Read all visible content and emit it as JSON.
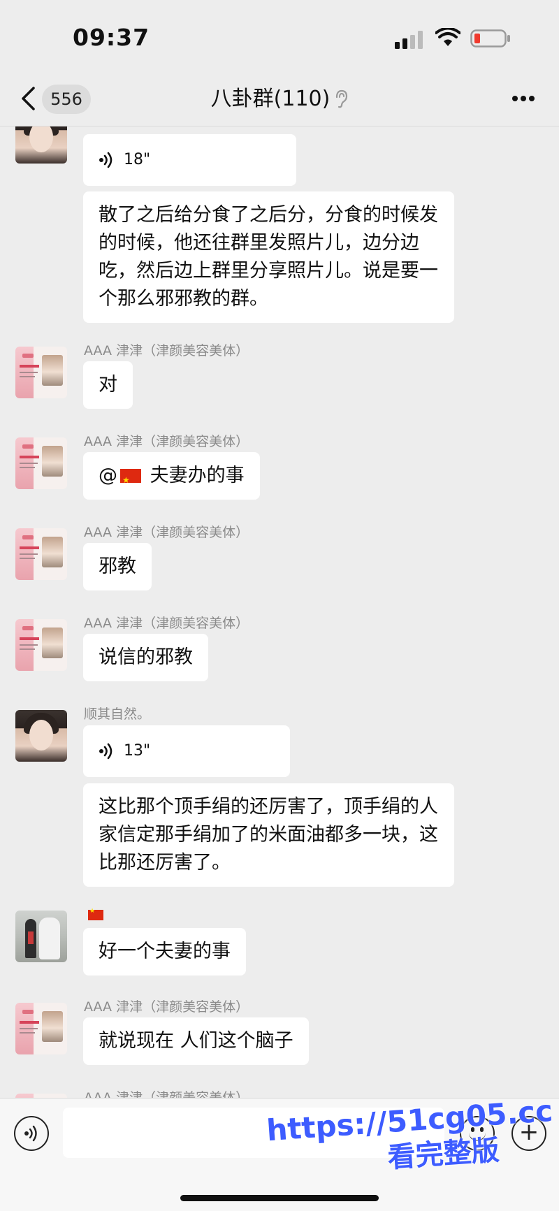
{
  "status_bar": {
    "time": "09:37"
  },
  "nav": {
    "back_count": "556",
    "title": "八卦群(110)"
  },
  "messages": [
    {
      "type": "voice",
      "duration": "18\""
    },
    {
      "type": "text",
      "text": "散了之后给分食了之后分，分食的时候发的时候，他还往群里发照片儿，边分边吃，然后边上群里分享照片儿。说是要一个那么邪邪教的群。"
    },
    {
      "sender": "AAA 津津（津颜美容美体）",
      "text": "对"
    },
    {
      "sender": "AAA 津津（津颜美容美体）",
      "mention": "@",
      "text": "夫妻办的事"
    },
    {
      "sender": "AAA 津津（津颜美容美体）",
      "text": "邪教"
    },
    {
      "sender": "AAA 津津（津颜美容美体）",
      "text": "说信的邪教"
    },
    {
      "sender": "顺其自然。",
      "type": "voice",
      "duration": "13\""
    },
    {
      "type": "text",
      "text": "这比那个顶手绢的还厉害了，顶手绢的人家信定那手绢加了的米面油都多一块，这比那还厉害了。"
    },
    {
      "sender_icon": "china-flag-icon",
      "text": "好一个夫妻的事"
    },
    {
      "sender": "AAA 津津（津颜美容美体）",
      "text": "就说现在 人们这个脑子"
    },
    {
      "sender": "AAA 津津（津颜美容美体）"
    }
  ],
  "watermark": {
    "line1": "https://51cg05.cc",
    "line2": "看完整版"
  },
  "colors": {
    "background": "#ededed",
    "bubble": "#ffffff",
    "sender_text": "#8b8b8b",
    "watermark": "#3d5cff"
  }
}
